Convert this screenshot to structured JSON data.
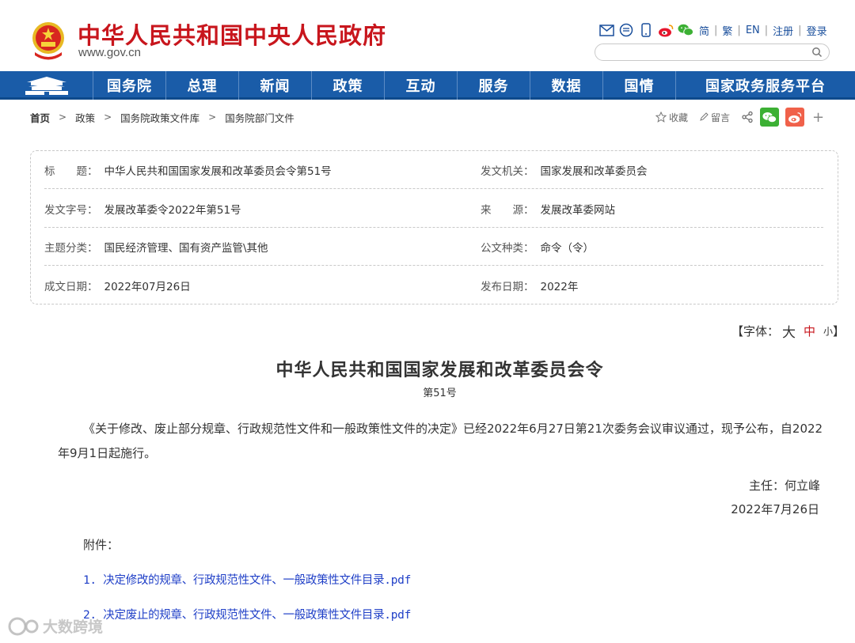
{
  "header": {
    "title": "中华人民共和国中央人民政府",
    "url": "www.gov.cn",
    "links": [
      "简",
      "繁",
      "EN",
      "注册",
      "登录"
    ],
    "search_placeholder": ""
  },
  "nav": {
    "items": [
      "国务院",
      "总理",
      "新闻",
      "政策",
      "互动",
      "服务",
      "数据",
      "国情",
      "国家政务服务平台"
    ]
  },
  "breadcrumb": [
    "首页",
    "政策",
    "国务院政策文件库",
    "国务院部门文件"
  ],
  "share": {
    "favorite": "收藏",
    "comment": "留言"
  },
  "info": {
    "title_label": "标　　题：",
    "title_value": "中华人民共和国国家发展和改革委员会令第51号",
    "issuer_label": "发文机关：",
    "issuer_value": "国家发展和改革委员会",
    "docno_label": "发文字号：",
    "docno_value": "发展改革委令2022年第51号",
    "source_label": "来　　源：",
    "source_value": "发展改革委网站",
    "topic_label": "主题分类：",
    "topic_value": "国民经济管理、国有资产监管\\其他",
    "type_label": "公文种类：",
    "type_value": "命令（令）",
    "written_label": "成文日期：",
    "written_value": "2022年07月26日",
    "publish_label": "发布日期：",
    "publish_value": "2022年"
  },
  "font_control": {
    "label": "【字体：",
    "big": "大",
    "mid": "中",
    "small": "小",
    "close": "】"
  },
  "article": {
    "title": "中华人民共和国国家发展和改革委员会令",
    "number": "第51号",
    "body": "《关于修改、废止部分规章、行政规范性文件和一般政策性文件的决定》已经2022年6月27日第21次委务会议审议通过，现予公布，自2022年9月1日起施行。",
    "signer": "主任：何立峰",
    "date": "2022年7月26日",
    "attachment_label": "附件：",
    "attachments": [
      "1. 决定修改的规章、行政规范性文件、一般政策性文件目录.pdf",
      "2. 决定废止的规章、行政规范性文件、一般政策性文件目录.pdf"
    ]
  },
  "watermark": "大数跨境",
  "colors": {
    "brand_red": "#c8161d",
    "nav_blue": "#1a5ca8",
    "link_blue": "#1f3fc7",
    "wechat_green": "#3cb034",
    "weibo_orange": "#f0614a"
  }
}
